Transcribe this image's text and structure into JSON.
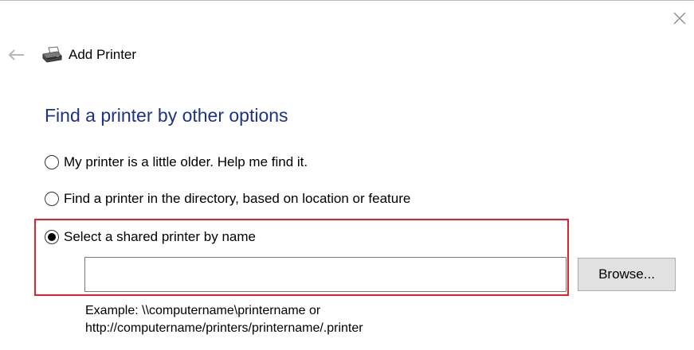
{
  "window": {
    "title": "Add Printer",
    "close_icon": "close-icon",
    "back_icon": "back-arrow-icon",
    "app_icon": "printer-icon"
  },
  "page": {
    "heading": "Find a printer by other options",
    "heading_color": "#1e3287"
  },
  "options": [
    {
      "label": "My printer is a little older. Help me find it.",
      "selected": false
    },
    {
      "label": "Find a printer in the directory, based on location or feature",
      "selected": false
    },
    {
      "label": "Select a shared printer by name",
      "selected": true
    }
  ],
  "shared_printer": {
    "value": "",
    "placeholder": "",
    "browse_label": "Browse...",
    "example_line1": "Example: \\\\computername\\printername or",
    "example_line2": "http://computername/printers/printername/.printer"
  },
  "colors": {
    "highlight_border": "#e0232b",
    "button_bg": "#e1e1e1"
  }
}
